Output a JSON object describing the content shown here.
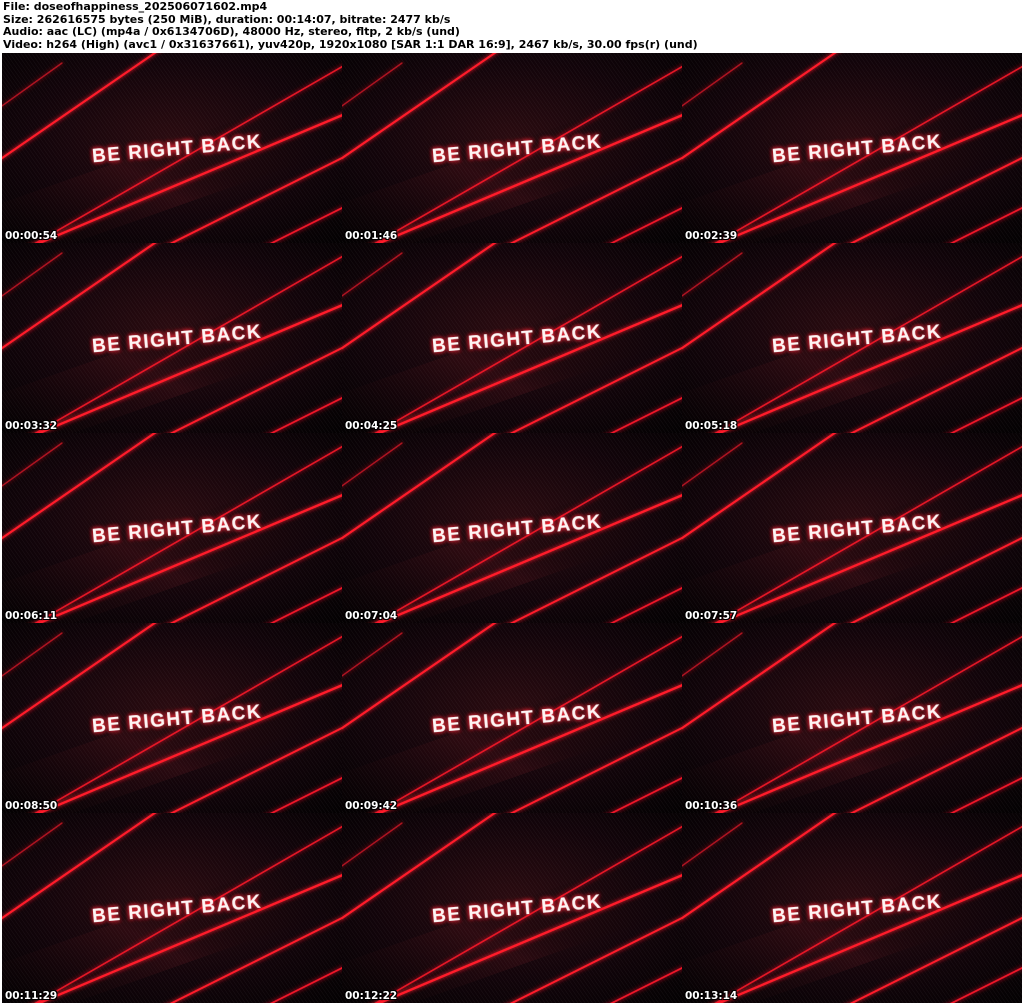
{
  "info": {
    "file": "File: doseofhappiness_202506071602.mp4",
    "size": "Size: 262616575 bytes (250 MiB), duration: 00:14:07, bitrate: 2477 kb/s",
    "audio": "Audio: aac (LC) (mp4a / 0x6134706D), 48000 Hz, stereo, fltp, 2 kb/s (und)",
    "video": "Video: h264 (High) (avc1 / 0x31637661), yuv420p, 1920x1080 [SAR 1:1 DAR 16:9], 2467 kb/s, 30.00 fps(r) (und)"
  },
  "frame_text": "BE RIGHT BACK",
  "colors": {
    "background": "#050102",
    "laser": "#ff1a2a",
    "glow": "#ff2a3a",
    "text": "#fff4f4"
  },
  "thumbnails": [
    {
      "timestamp": "00:00:54"
    },
    {
      "timestamp": "00:01:46"
    },
    {
      "timestamp": "00:02:39"
    },
    {
      "timestamp": "00:03:32"
    },
    {
      "timestamp": "00:04:25"
    },
    {
      "timestamp": "00:05:18"
    },
    {
      "timestamp": "00:06:11"
    },
    {
      "timestamp": "00:07:04"
    },
    {
      "timestamp": "00:07:57"
    },
    {
      "timestamp": "00:08:50"
    },
    {
      "timestamp": "00:09:42"
    },
    {
      "timestamp": "00:10:36"
    },
    {
      "timestamp": "00:11:29"
    },
    {
      "timestamp": "00:12:22"
    },
    {
      "timestamp": "00:13:14"
    }
  ]
}
